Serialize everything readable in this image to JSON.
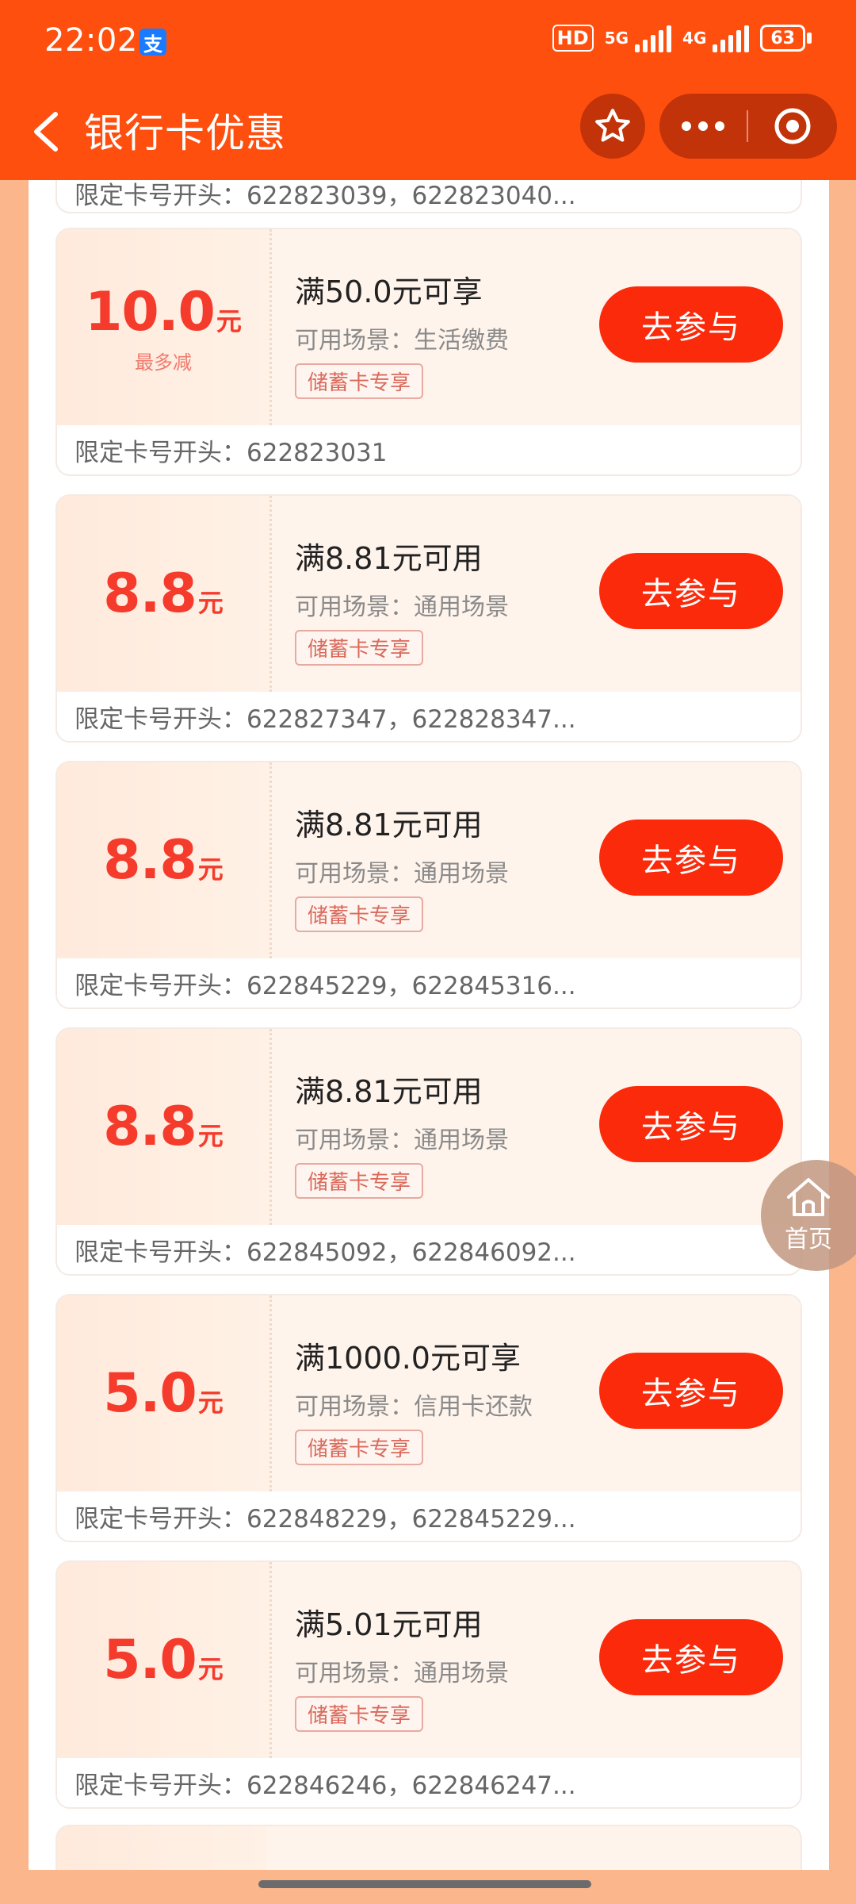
{
  "status": {
    "time": "22:02",
    "app_badge": "支",
    "hd": "HD",
    "net1": "5G",
    "net2": "4G",
    "battery": "63"
  },
  "header": {
    "title": "银行卡优惠"
  },
  "partial_top_text": "限定卡号开头：622823039，622823040...",
  "coupons": [
    {
      "amount": "10.0",
      "unit": "元",
      "sub": "最多减",
      "title": "满50.0元可享",
      "scene": "可用场景：生活缴费",
      "tag": "储蓄卡专享",
      "button": "去参与",
      "cards": "限定卡号开头：622823031"
    },
    {
      "amount": "8.8",
      "unit": "元",
      "title": "满8.81元可用",
      "scene": "可用场景：通用场景",
      "tag": "储蓄卡专享",
      "button": "去参与",
      "cards": "限定卡号开头：622827347，622828347..."
    },
    {
      "amount": "8.8",
      "unit": "元",
      "title": "满8.81元可用",
      "scene": "可用场景：通用场景",
      "tag": "储蓄卡专享",
      "button": "去参与",
      "cards": "限定卡号开头：622845229，622845316..."
    },
    {
      "amount": "8.8",
      "unit": "元",
      "title": "满8.81元可用",
      "scene": "可用场景：通用场景",
      "tag": "储蓄卡专享",
      "button": "去参与",
      "cards": "限定卡号开头：622845092，622846092..."
    },
    {
      "amount": "5.0",
      "unit": "元",
      "title": "满1000.0元可享",
      "scene": "可用场景：信用卡还款",
      "tag": "储蓄卡专享",
      "button": "去参与",
      "cards": "限定卡号开头：622848229，622845229..."
    },
    {
      "amount": "5.0",
      "unit": "元",
      "title": "满5.01元可用",
      "scene": "可用场景：通用场景",
      "tag": "储蓄卡专享",
      "button": "去参与",
      "cards": "限定卡号开头：622846246，622846247..."
    }
  ],
  "float_home": {
    "label": "首页"
  },
  "colors": {
    "brand": "#ff4f0f",
    "button": "#fa2a0b",
    "amount": "#f43b2c"
  }
}
